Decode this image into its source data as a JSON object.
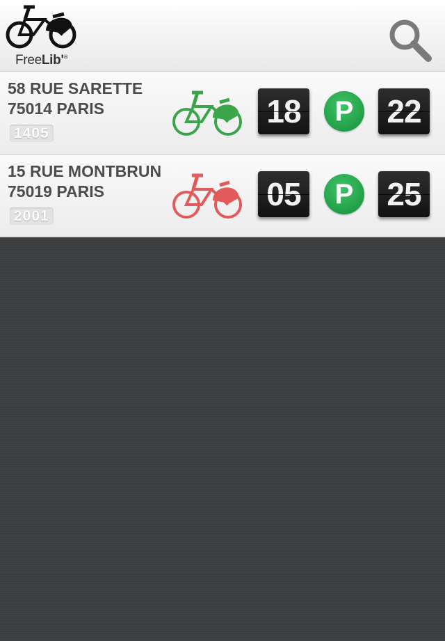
{
  "header": {
    "logo_free": "Free",
    "logo_lib": "Lib'",
    "logo_reg": "®",
    "search_icon": "search-icon"
  },
  "stations": [
    {
      "address_line1": "58 RUE SARETTE",
      "address_line2": "75014 PARIS",
      "station_number": "1405",
      "bikes_available": "18",
      "parking_icon_label": "P",
      "slots_available": "22",
      "status_color": "#3aa54b",
      "bike_icon": "bike-icon-green"
    },
    {
      "address_line1": "15 RUE MONTBRUN",
      "address_line2": "75019 PARIS",
      "station_number": "2001",
      "bikes_available": "05",
      "parking_icon_label": "P",
      "slots_available": "25",
      "status_color": "#e25a5a",
      "bike_icon": "bike-icon-red"
    }
  ],
  "colors": {
    "parking_green": "#1fa046",
    "background_dark": "#3e3f41"
  }
}
